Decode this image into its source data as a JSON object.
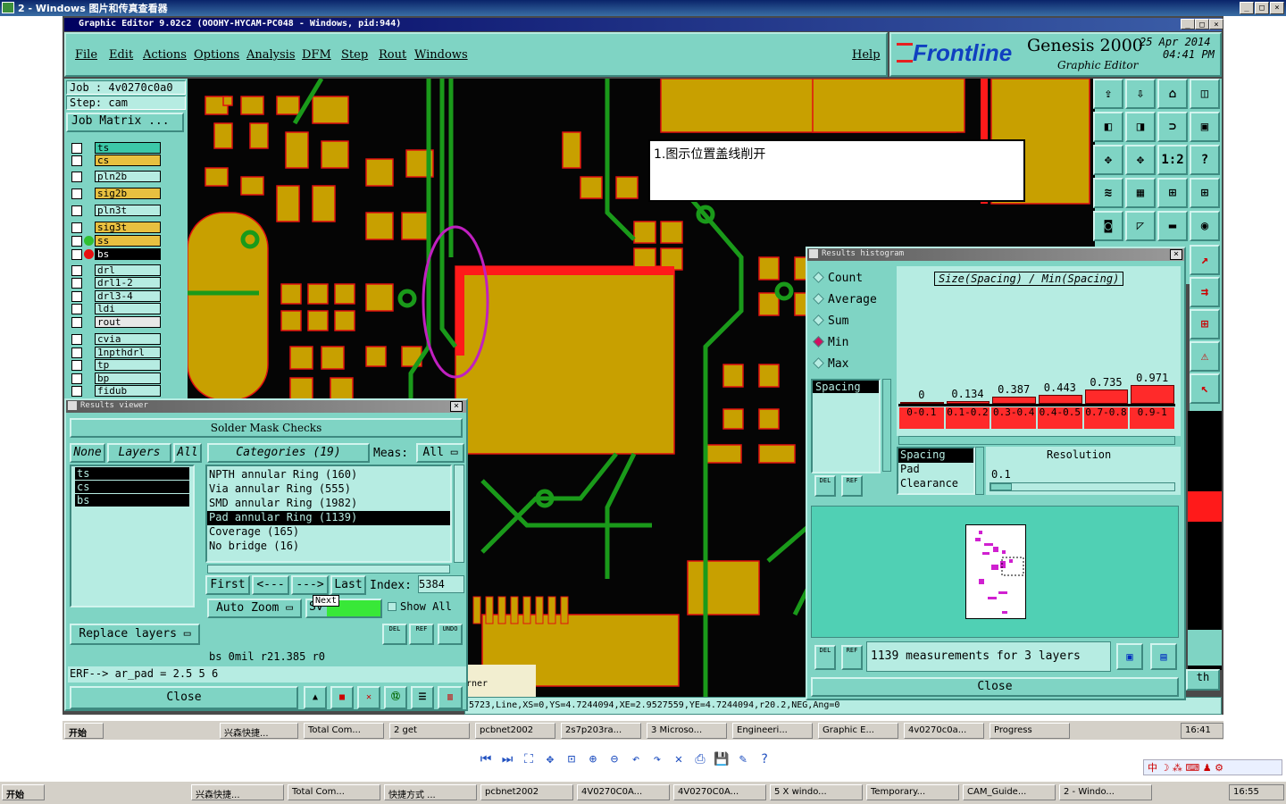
{
  "outer_title": "2 - Windows 图片和传真查看器",
  "graphic_title": "Graphic Editor 9.02c2  (OOOHY-HYCAM-PC048 - Windows, pid:944)",
  "menu": [
    "File",
    "Edit",
    "Actions",
    "Options",
    "Analysis",
    "DFM",
    "Step",
    "Rout",
    "Windows"
  ],
  "help": "Help",
  "brand": {
    "logo": "Frontline",
    "product": "Genesis 2000",
    "sub": "Graphic Editor",
    "date": "25 Apr 2014",
    "time": "04:41 PM"
  },
  "job": {
    "job": "Job : 4v0270c0a0",
    "step": "Step: cam",
    "matrix": "Job Matrix ..."
  },
  "layers": [
    "ts",
    "cs",
    "pln2b",
    "sig2b",
    "pln3t",
    "sig3t",
    "ss",
    "bs",
    "drl",
    "drl1-2",
    "drl3-4",
    "ldi",
    "rout",
    "cvia",
    "1npthdrl",
    "tp",
    "bp",
    "fidub"
  ],
  "annotation": "1.图示位置盖线削开",
  "rv": {
    "title": "Results viewer",
    "header": "Solder Mask Checks",
    "none": "None",
    "layers": "Layers",
    "all": "All",
    "categories": "Categories (19)",
    "meas_label": "Meas:",
    "meas_value": "All",
    "layer_list": [
      "ts",
      "cs",
      "bs"
    ],
    "cat_list": [
      "NPTH annular Ring (160)",
      "Via annular Ring (555)",
      "SMD annular Ring (1982)",
      "Pad annular Ring (1139)",
      "Coverage (165)",
      "No bridge (16)"
    ],
    "first": "First",
    "prev": "<---",
    "next": "--->",
    "last": "Last",
    "index_label": "Index:",
    "index_value": "5384",
    "auto_zoom": "Auto Zoom",
    "sv": "Sv",
    "tooltip": "Next",
    "show_all": "Show All",
    "replace_layers": "Replace layers",
    "status": "bs 0mil  r21.385  r0",
    "erf": "ERF--> ar_pad = 2.5 5 6",
    "close": "Close",
    "del": "DEL",
    "ref": "REF",
    "undo": "UNDO"
  },
  "rh": {
    "title": "Results histogram",
    "options": [
      "Count",
      "Average",
      "Sum",
      "Min",
      "Max"
    ],
    "selected_option": "Min",
    "graph_title": "Size(Spacing) / Min(Spacing)",
    "values": [
      "0",
      "0.134",
      "0.387",
      "0.443",
      "0.735",
      "0.971"
    ],
    "ranges": [
      "0-0.1",
      "0.1-0.2",
      "0.3-0.4",
      "0.4-0.5",
      "0.7-0.8",
      "0.9-1"
    ],
    "left_list": [
      "Spacing"
    ],
    "meas_list": [
      "Spacing",
      "Pad",
      "Clearance"
    ],
    "resolution_label": "Resolution",
    "resolution_value": "0.1",
    "summary": "1139 measurements for 3 layers",
    "close": "Close",
    "del": "DEL",
    "ref": "REF"
  },
  "canvas_status": "5723,Line,XS=0,YS=4.7244094,XE=2.9527559,YE=4.7244094,r20.2,NEG,Ang=0",
  "canvas_partial": "rner",
  "right_edge_label": "th",
  "inner_taskbar": {
    "start": "开始",
    "items": [
      "兴森快捷...",
      "Total Com...",
      "2 get",
      "pcbnet2002",
      "2s7p203ra...",
      "3 Microso...",
      "Engineeri...",
      "Graphic E...",
      "4v0270c0a...",
      "Progress"
    ],
    "time": "16:41"
  },
  "outer_taskbar": {
    "start": "开始",
    "items": [
      "兴森快捷...",
      "Total Com...",
      "快捷方式 ...",
      "pcbnet2002",
      "4V0270C0A...",
      "4V0270C0A...",
      "5 X windo...",
      "Temporary...",
      "CAM_Guide...",
      "2 - Windo..."
    ],
    "time": "16:55"
  },
  "tray_label": "中"
}
